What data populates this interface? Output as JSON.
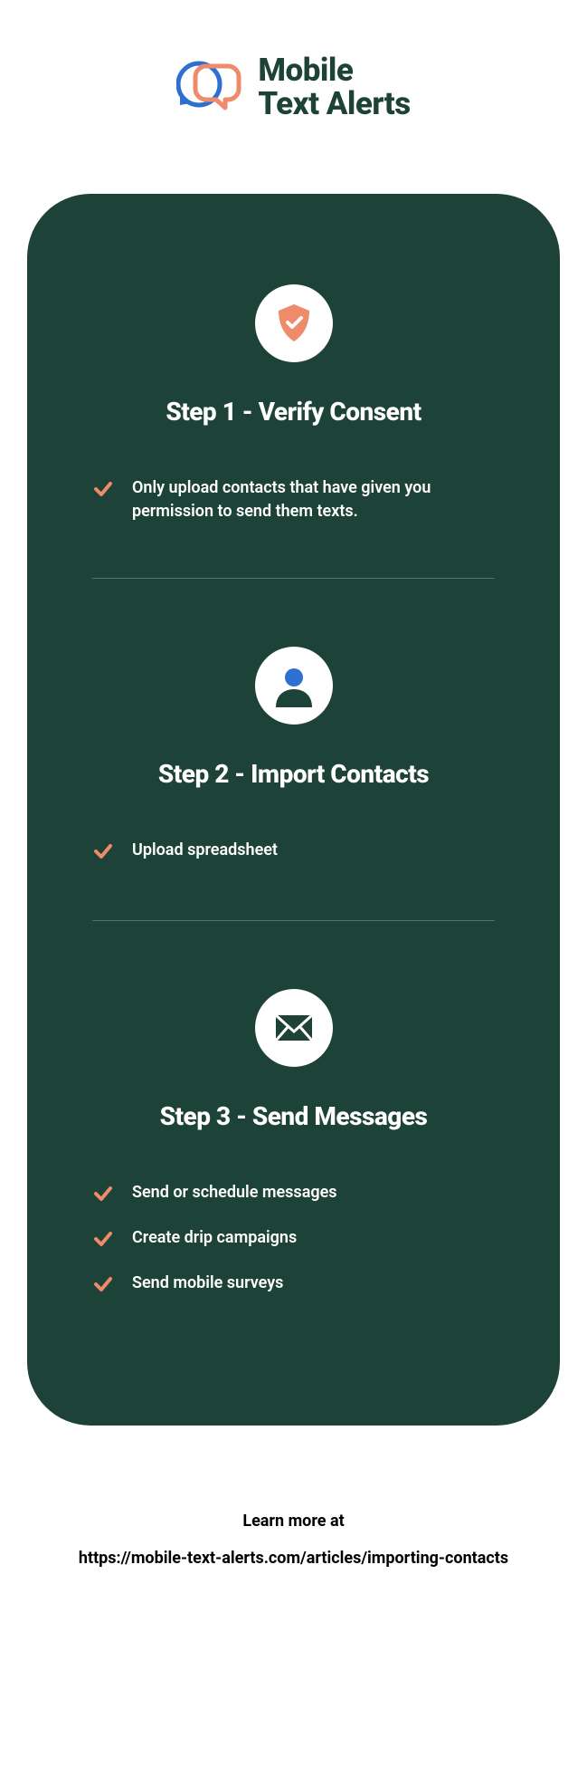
{
  "brand": {
    "line1": "Mobile",
    "line2": "Text Alerts"
  },
  "steps": [
    {
      "title": "Step 1 - Verify Consent",
      "items": [
        "Only upload contacts that have given you permission to send them texts."
      ]
    },
    {
      "title": "Step 2 - Import Contacts",
      "items": [
        "Upload spreadsheet"
      ]
    },
    {
      "title": "Step 3 - Send Messages",
      "items": [
        "Send or schedule messages",
        "Create drip campaigns",
        "Send mobile surveys"
      ]
    }
  ],
  "footer": {
    "lead": "Learn more at",
    "url": "https://mobile-text-alerts.com/articles/importing-contacts"
  }
}
